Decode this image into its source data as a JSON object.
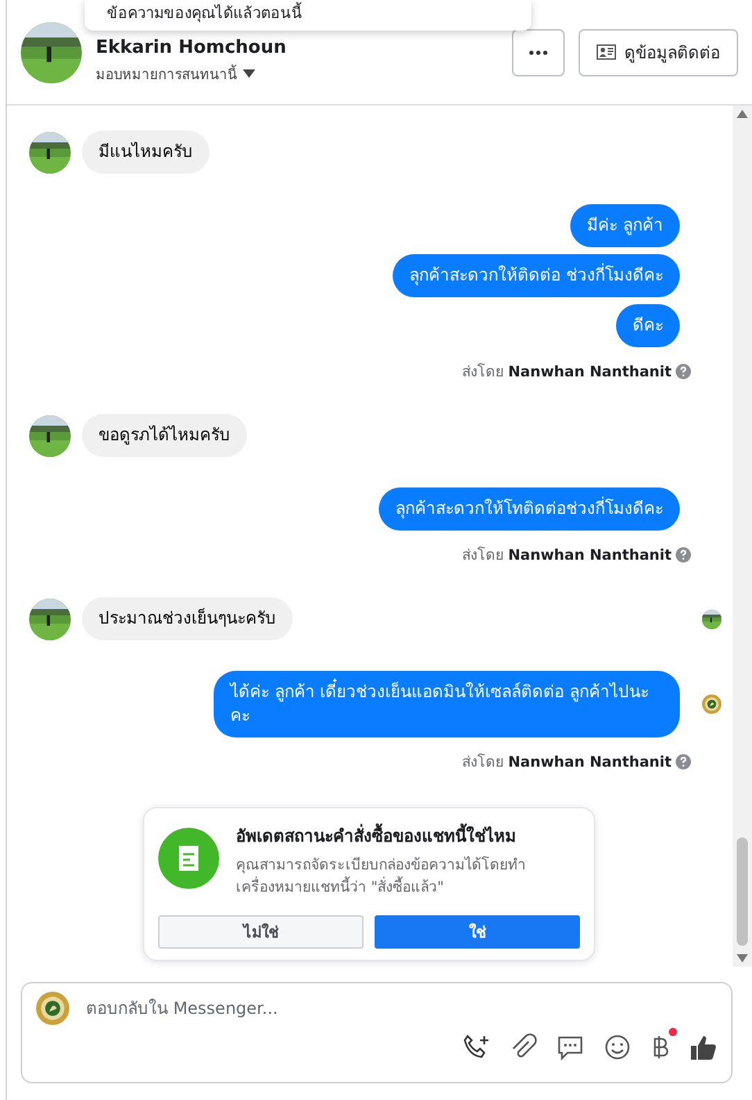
{
  "header": {
    "tooltip": "ข้อความของคุณได้แล้วตอนนี้",
    "name": "Ekkarin Homchoun",
    "subtitle": "มอบหมายการสนทนานี้",
    "contact_button": "ดูข้อมูลติดต่อ"
  },
  "messages": [
    {
      "kind": "incoming",
      "texts": [
        "มีแนไหมครับ"
      ],
      "read_receipt": false
    },
    {
      "kind": "outgoing",
      "texts": [
        "มีค่ะ ลูกค้า",
        "ลุกค้าสะดวกให้ติดต่อ ช่วงกี่โมงดีคะ",
        "ดีคะ"
      ],
      "sent_by_prefix": "ส่งโดย",
      "sender": "Nanwhan Nanthanit",
      "read_receipt": false
    },
    {
      "kind": "incoming",
      "texts": [
        "ขอดูรภได้ไหมครับ"
      ],
      "read_receipt": false
    },
    {
      "kind": "outgoing",
      "texts": [
        "ลุกค้าสะดวกให้โทติดต่อช่วงกี่โมงดีคะ"
      ],
      "sent_by_prefix": "ส่งโดย",
      "sender": "Nanwhan Nanthanit",
      "read_receipt": false
    },
    {
      "kind": "incoming",
      "texts": [
        "ประมาณช่วงเย็นๆนะครับ"
      ],
      "read_receipt": true
    },
    {
      "kind": "outgoing",
      "texts": [
        "ได้ค่ะ ลูกค้า เดี๋ยวช่วงเย็นแอดมินให้เซลล์ติดต่อ ลูกค้าไปนะคะ"
      ],
      "sent_by_prefix": "ส่งโดย",
      "sender": "Nanwhan Nanthanit",
      "read_receipt": true
    }
  ],
  "card": {
    "title": "อัพเดตสถานะคำสั่งซื้อของแชทนี้ใช่ไหม",
    "body": "คุณสามารถจัดระเบียบกล่องข้อความได้โดยทำเครื่องหมายแชทนี้ว่า \"สั่งซื้อแล้ว\"",
    "buttons": [
      {
        "label": "ไม่ใช่",
        "primary": false
      },
      {
        "label": "ใช่",
        "primary": true
      }
    ]
  },
  "composer": {
    "placeholder": "ตอบกลับใน Messenger...",
    "baht_badge": true
  }
}
